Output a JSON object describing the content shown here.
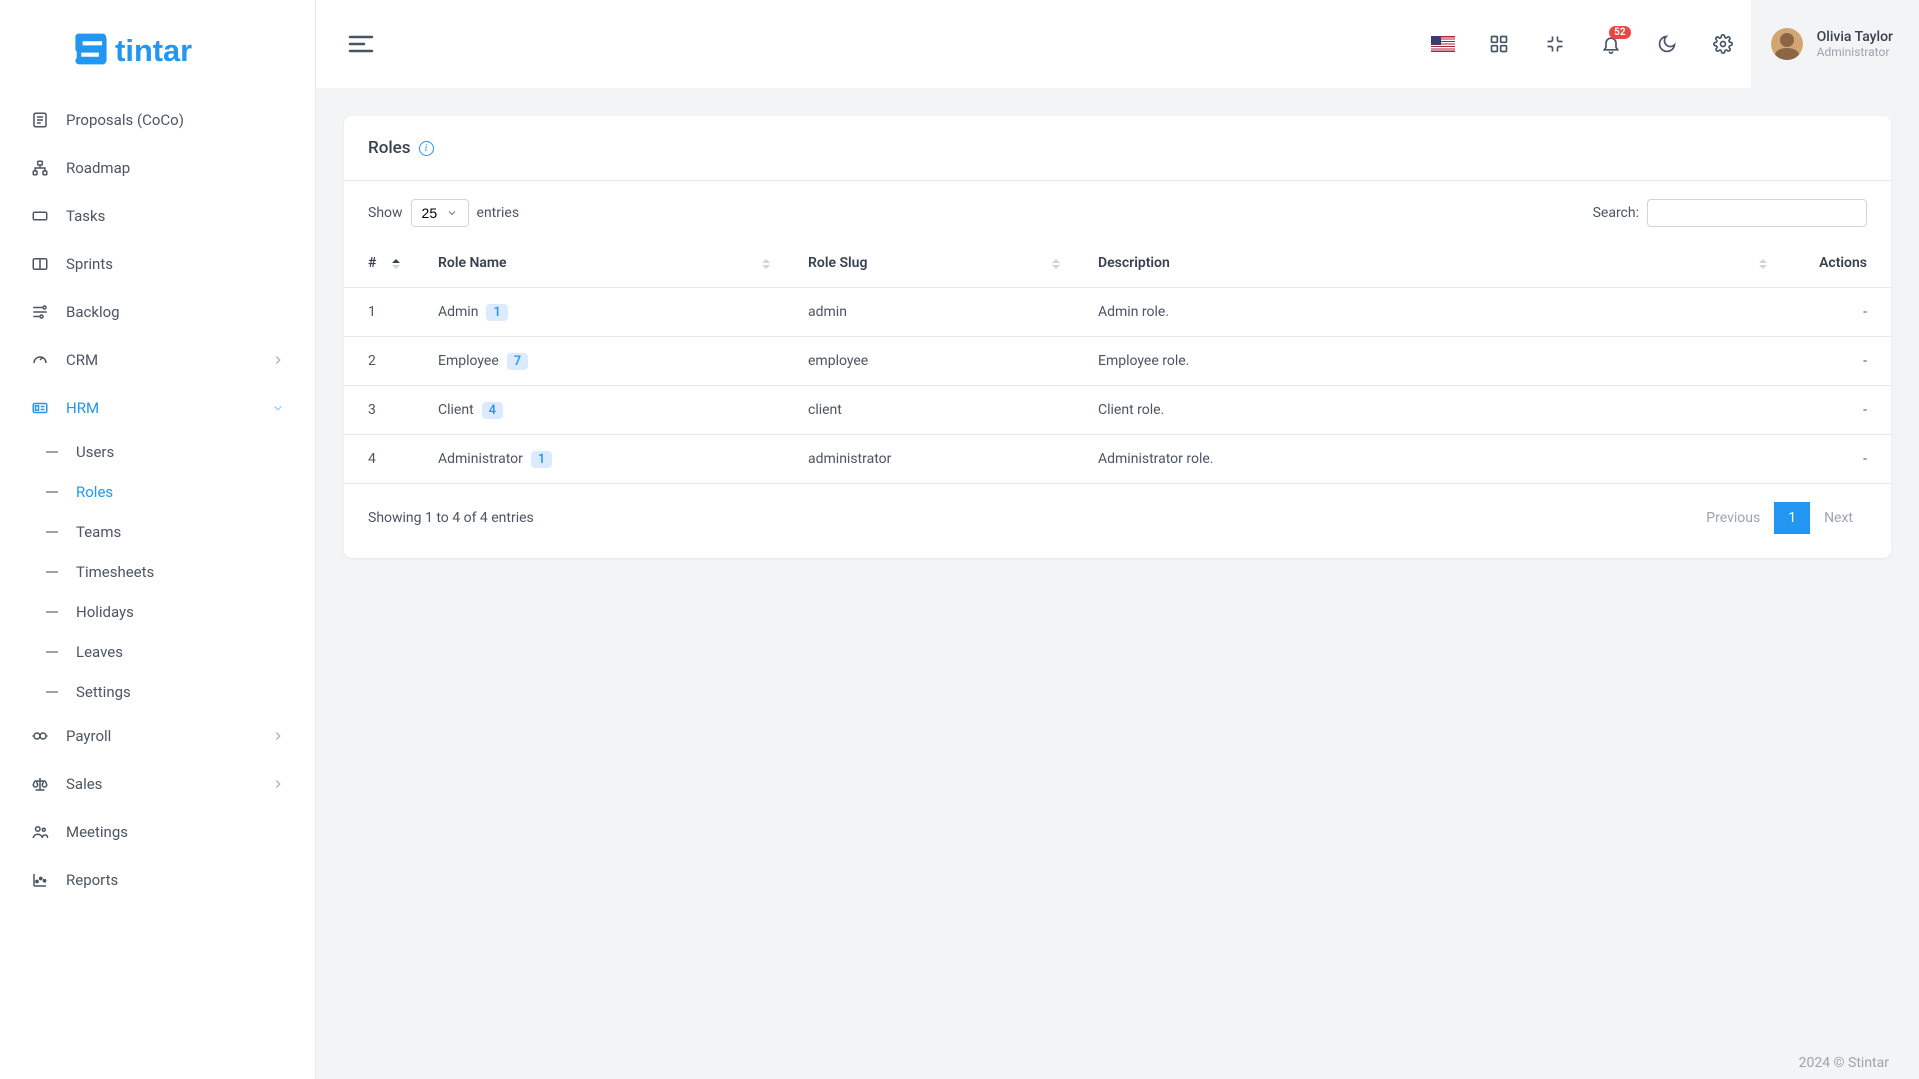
{
  "brand": {
    "name": "Stintar"
  },
  "header": {
    "notif_count": "52",
    "user_name": "Olivia Taylor",
    "user_role": "Administrator"
  },
  "sidebar": {
    "items": [
      {
        "label": "Proposals (CoCo)"
      },
      {
        "label": "Roadmap"
      },
      {
        "label": "Tasks"
      },
      {
        "label": "Sprints"
      },
      {
        "label": "Backlog"
      },
      {
        "label": "CRM"
      },
      {
        "label": "HRM"
      },
      {
        "label": "Payroll"
      },
      {
        "label": "Sales"
      },
      {
        "label": "Meetings"
      },
      {
        "label": "Reports"
      }
    ],
    "hrm_sub": [
      {
        "label": "Users"
      },
      {
        "label": "Roles"
      },
      {
        "label": "Teams"
      },
      {
        "label": "Timesheets"
      },
      {
        "label": "Holidays"
      },
      {
        "label": "Leaves"
      },
      {
        "label": "Settings"
      }
    ]
  },
  "page": {
    "title": "Roles",
    "show_label_pre": "Show",
    "show_label_post": "entries",
    "show_value": "25",
    "search_label": "Search:",
    "columns": {
      "idx": "#",
      "name": "Role Name",
      "slug": "Role Slug",
      "desc": "Description",
      "actions": "Actions"
    },
    "rows": [
      {
        "idx": "1",
        "name": "Admin",
        "count": "1",
        "slug": "admin",
        "desc": "Admin role.",
        "actions": "-"
      },
      {
        "idx": "2",
        "name": "Employee",
        "count": "7",
        "slug": "employee",
        "desc": "Employee role.",
        "actions": "-"
      },
      {
        "idx": "3",
        "name": "Client",
        "count": "4",
        "slug": "client",
        "desc": "Client role.",
        "actions": "-"
      },
      {
        "idx": "4",
        "name": "Administrator",
        "count": "1",
        "slug": "administrator",
        "desc": "Administrator role.",
        "actions": "-"
      }
    ],
    "summary": "Showing 1 to 4 of 4 entries",
    "pager": {
      "prev": "Previous",
      "pages": [
        "1"
      ],
      "next": "Next"
    }
  },
  "footer": "2024 © Stintar"
}
